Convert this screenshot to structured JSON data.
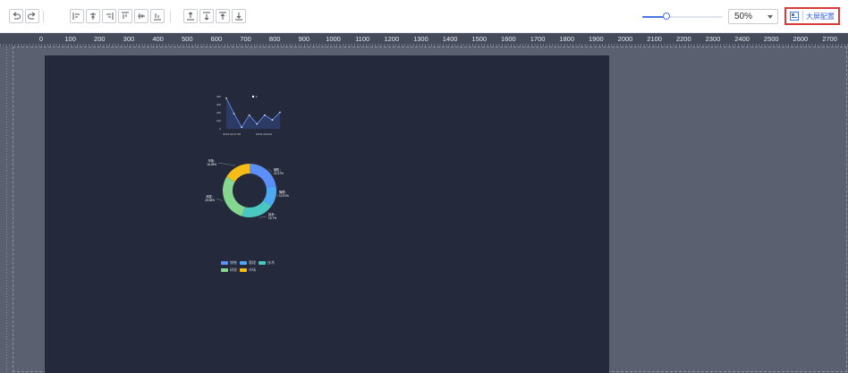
{
  "toolbar": {
    "buttons": [
      {
        "name": "undo-button",
        "icon": "undo-icon"
      },
      {
        "name": "redo-button",
        "icon": "redo-icon"
      },
      {
        "name": "align-left-button",
        "icon": "align-left-icon"
      },
      {
        "name": "align-center-button",
        "icon": "align-center-icon"
      },
      {
        "name": "align-right-button",
        "icon": "align-right-icon"
      },
      {
        "name": "align-top-button",
        "icon": "align-top-icon"
      },
      {
        "name": "align-middle-button",
        "icon": "align-middle-icon"
      },
      {
        "name": "align-bottom-button",
        "icon": "align-bottom-icon"
      },
      {
        "name": "bring-front-button",
        "icon": "bring-front-icon"
      },
      {
        "name": "bring-forward-button",
        "icon": "bring-forward-icon"
      },
      {
        "name": "move-top-button",
        "icon": "move-top-icon"
      },
      {
        "name": "move-bottom-button",
        "icon": "move-bottom-icon"
      }
    ],
    "zoom_slider_fraction": 0.3,
    "zoom_value": "50%",
    "bigscreen_label": "大屏配置"
  },
  "ruler": {
    "labels": [
      "0",
      "100",
      "200",
      "300",
      "400",
      "500",
      "600",
      "700",
      "800",
      "900",
      "1000",
      "1100",
      "1200",
      "1300",
      "1400",
      "1500",
      "1600",
      "1700",
      "1800",
      "1900",
      "2000",
      "2100",
      "2200",
      "2300",
      "2400",
      "2500",
      "2600",
      "2700"
    ]
  },
  "colors": {
    "accent": "#4a78e6",
    "screen_bg": "#242a3b",
    "workspace_bg": "#5b6070",
    "highlight_border": "#d93b3b"
  },
  "chart_data": [
    {
      "type": "line",
      "y_ticks": [
        "400",
        "300",
        "200",
        "100",
        "0"
      ],
      "x_tick_labels": [
        "01/01 00:17:06",
        "01/01 00:03:0"
      ],
      "ylim": [
        0,
        400
      ],
      "legend": "1",
      "series": [
        {
          "name": "1",
          "values": [
            380,
            190,
            20,
            170,
            60,
            170,
            110,
            205
          ]
        }
      ]
    },
    {
      "type": "pie",
      "slices": [
        {
          "name": "销售",
          "value": 22.37,
          "label": "销售：22.37%",
          "color": "#5b8ff9"
        },
        {
          "name": "管理",
          "value": 12.51,
          "label": "管理：12.51%",
          "color": "#4fa8f2"
        },
        {
          "name": "技术",
          "value": 19.7,
          "label": "技术：19.7%",
          "color": "#4ac7c0"
        },
        {
          "name": "研发",
          "value": 29.08,
          "label": "研发：29.08%",
          "color": "#85d68f"
        },
        {
          "name": "市场",
          "value": 16.28,
          "label": "市场：16.28%",
          "color": "#f6bd16"
        }
      ]
    }
  ]
}
